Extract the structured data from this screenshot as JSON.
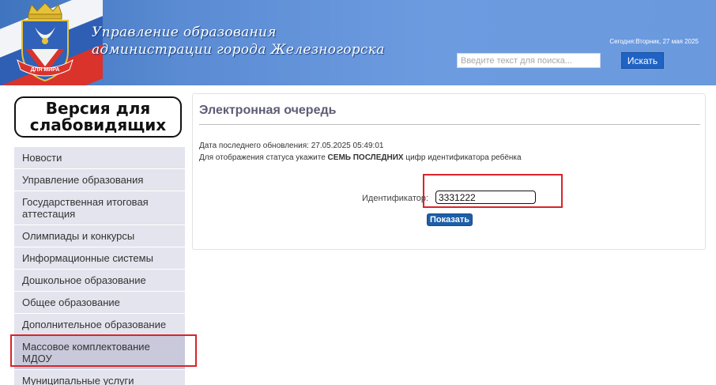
{
  "header": {
    "title_line1": "Управление образования",
    "title_line2": "администрации города Железногорска",
    "date_text": "Сегодня:Вторник, 27 мая 2025",
    "search_placeholder": "Введите текст для поиска...",
    "search_button": "Искать",
    "crest_motto": "ДЛЯ МИРА"
  },
  "sidebar": {
    "vision_line1": "Версия для",
    "vision_line2": "слабовидящих",
    "items": [
      {
        "label": "Новости"
      },
      {
        "label": "Управление образования"
      },
      {
        "label": "Государственная итоговая аттестация"
      },
      {
        "label": "Олимпиады и конкурсы"
      },
      {
        "label": "Информационные системы"
      },
      {
        "label": "Дошкольное образование"
      },
      {
        "label": "Общее образование"
      },
      {
        "label": "Дополнительное образование"
      },
      {
        "label": "Массовое комплектование МДОУ"
      },
      {
        "label": "Муниципальные услуги"
      }
    ]
  },
  "main": {
    "title": "Электронная очередь",
    "last_update": "Дата последнего обновления: 27.05.2025 05:49:01",
    "hint_before": "Для отображения статуса укажите",
    "hint_bold": "СЕМЬ ПОСЛЕДНИХ",
    "hint_after": "цифр идентификатора ребёнка",
    "id_label": "Идентификатор:",
    "id_value": "3331222",
    "show_button": "Показать"
  },
  "colors": {
    "header_blue": "#5a8bd3",
    "button_blue": "#1f63c4",
    "menu_bg": "#e4e4ee",
    "highlight_red": "#d9242b"
  }
}
